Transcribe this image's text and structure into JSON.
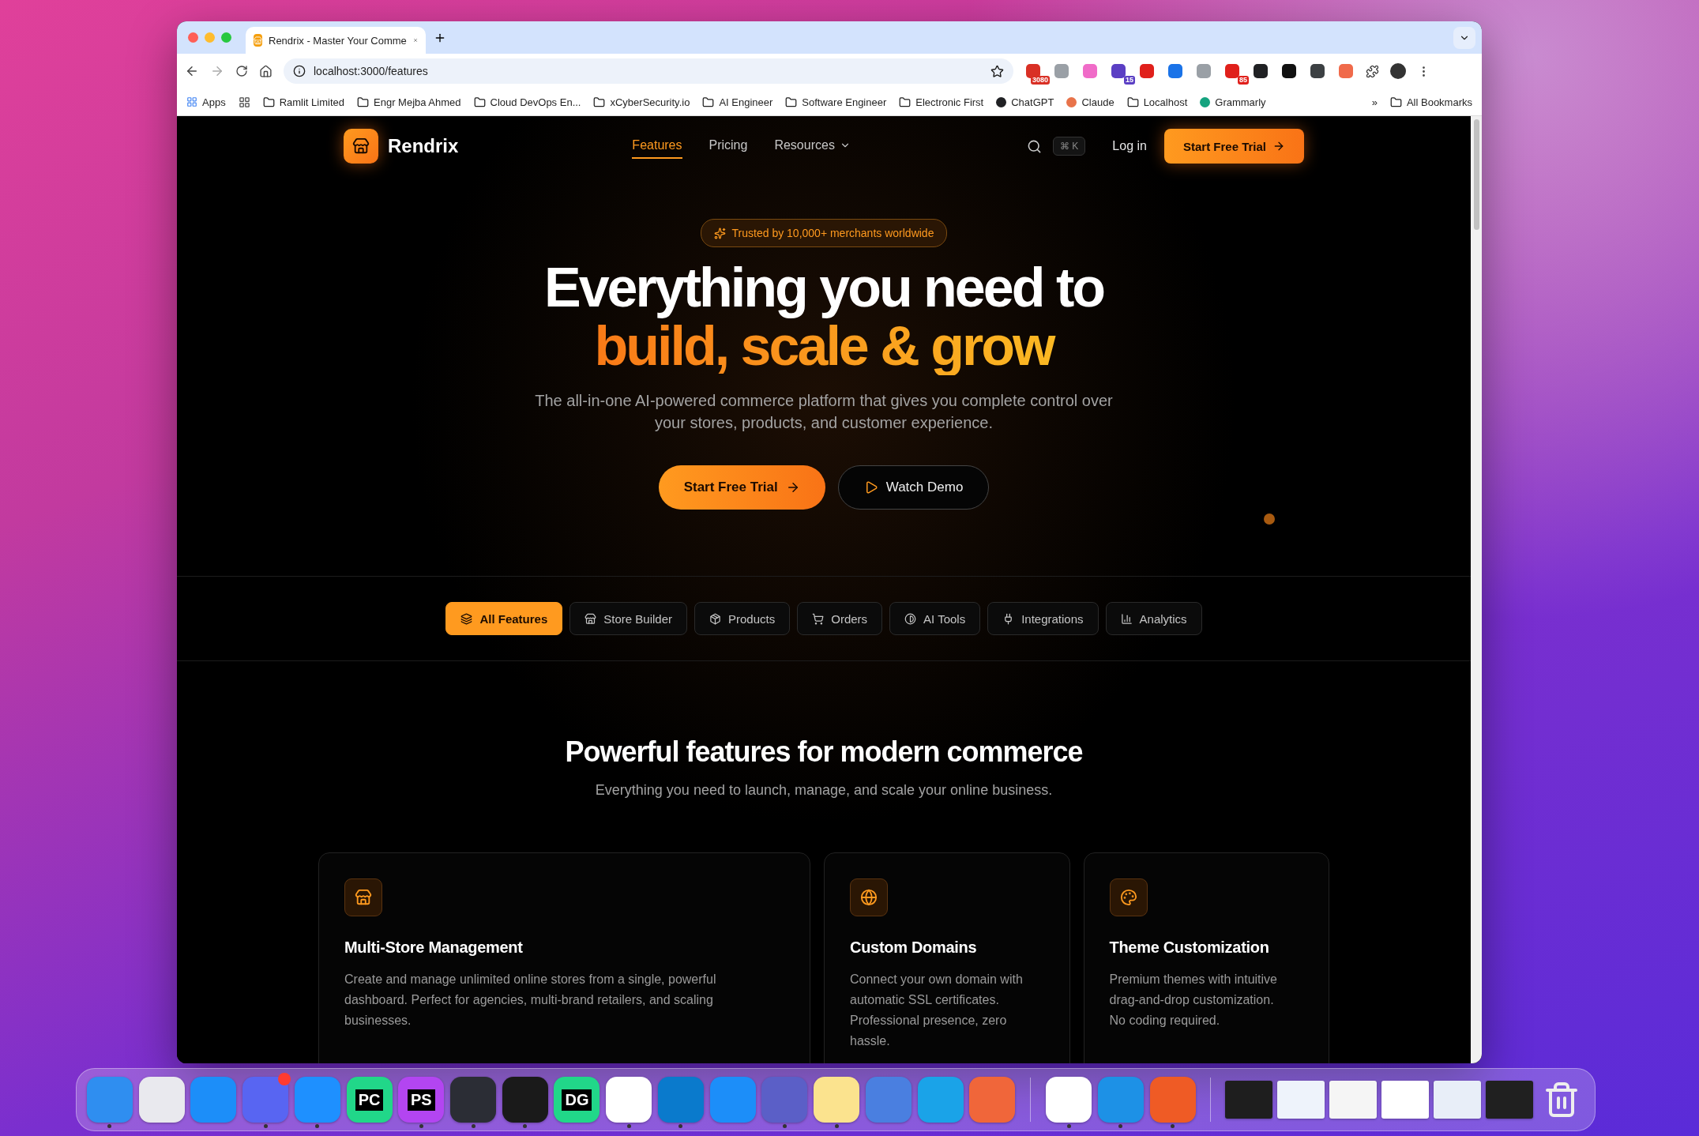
{
  "browser": {
    "tab": {
      "title": "Rendrix - Master Your Comme",
      "selected": true
    },
    "url": "localhost:3000/features",
    "extensions": [
      {
        "badge": "3080",
        "color": "#d93025"
      },
      {
        "color": "#9aa0a6"
      },
      {
        "color": "#f06bc8"
      },
      {
        "badge": "15",
        "color": "#5b3fc4"
      },
      {
        "color": "#e0201b"
      },
      {
        "color": "#1a73e8"
      },
      {
        "color": "#9aa0a6"
      },
      {
        "badge": "85",
        "color": "#e0201b"
      },
      {
        "color": "#202124"
      },
      {
        "color": "#111111"
      },
      {
        "color": "#3c4043"
      },
      {
        "color": "#f06a4a"
      }
    ],
    "bookmarks": [
      {
        "kind": "apps",
        "label": "Apps"
      },
      {
        "kind": "grid"
      },
      {
        "kind": "folder",
        "label": "Ramlit Limited"
      },
      {
        "kind": "folder",
        "label": "Engr Mejba Ahmed"
      },
      {
        "kind": "folder",
        "label": "Cloud DevOps En..."
      },
      {
        "kind": "folder",
        "label": "xCyberSecurity.io"
      },
      {
        "kind": "folder",
        "label": "AI Engineer"
      },
      {
        "kind": "folder",
        "label": "Software Engineer"
      },
      {
        "kind": "folder",
        "label": "Electronic First"
      },
      {
        "kind": "site",
        "label": "ChatGPT",
        "color": "#202124"
      },
      {
        "kind": "site",
        "label": "Claude",
        "color": "#e8734a"
      },
      {
        "kind": "folder",
        "label": "Localhost"
      },
      {
        "kind": "site",
        "label": "Grammarly",
        "color": "#15a37f"
      }
    ],
    "more_bookmarks": "»",
    "all_bookmarks": "All Bookmarks"
  },
  "site": {
    "brand": "Rendrix",
    "nav": [
      {
        "label": "Features",
        "selected": true
      },
      {
        "label": "Pricing",
        "selected": false
      },
      {
        "label": "Resources",
        "selected": false,
        "dropdown": true
      }
    ],
    "shortcut": "⌘ K",
    "login": "Log in",
    "cta": "Start Free Trial",
    "hero": {
      "badge": "Trusted by 10,000+ merchants worldwide",
      "title_line1": "Everything you need to",
      "title_line2": "build, scale & grow",
      "subtitle": "The all-in-one AI-powered commerce platform that gives you complete control over your stores, products, and customer experience.",
      "primary": "Start Free Trial",
      "secondary": "Watch Demo"
    },
    "filters": [
      {
        "label": "All Features",
        "selected": true
      },
      {
        "label": "Store Builder",
        "selected": false
      },
      {
        "label": "Products",
        "selected": false
      },
      {
        "label": "Orders",
        "selected": false
      },
      {
        "label": "AI Tools",
        "selected": false
      },
      {
        "label": "Integrations",
        "selected": false
      },
      {
        "label": "Analytics",
        "selected": false
      }
    ],
    "section": {
      "heading": "Powerful features for modern commerce",
      "subheading": "Everything you need to launch, manage, and scale your online business."
    },
    "cards": [
      {
        "title": "Multi-Store Management",
        "text": "Create and manage unlimited online stores from a single, powerful dashboard. Perfect for agencies, multi-brand retailers, and scaling businesses."
      },
      {
        "title": "Custom Domains",
        "text": "Connect your own domain with automatic SSL certificates. Professional presence, zero hassle."
      },
      {
        "title": "Theme Customization",
        "text": "Premium themes with intuitive drag-and-drop customization. No coding required."
      }
    ]
  },
  "dock": {
    "apps": [
      {
        "color": "#2f8ef0",
        "running": true
      },
      {
        "color": "#e9e9ee",
        "running": false
      },
      {
        "color": "#1c8ef9",
        "running": false
      },
      {
        "color": "#5865f2",
        "running": true,
        "notification": true
      },
      {
        "color": "#1e90ff",
        "running": true
      },
      {
        "color": "#21d789",
        "label": "PC",
        "running": false
      },
      {
        "color": "#b345f1",
        "label": "PS",
        "running": true
      },
      {
        "color": "#2b2d35",
        "running": true
      },
      {
        "color": "#1a1a1a",
        "running": true
      },
      {
        "color": "#21d789",
        "label": "DG",
        "running": false
      },
      {
        "color": "#ffffff",
        "running": true
      },
      {
        "color": "#0a7acc",
        "running": true
      },
      {
        "color": "#1c8ef9",
        "running": false
      },
      {
        "color": "#5b5fc7",
        "running": true
      },
      {
        "color": "#fbe38e",
        "running": true
      },
      {
        "color": "#4a7fe0",
        "running": false
      },
      {
        "color": "#1aa3e8",
        "running": false
      },
      {
        "color": "#f0663a",
        "running": false
      }
    ],
    "apps2": [
      {
        "color": "#ffffff",
        "running": true
      },
      {
        "color": "#1d91e6",
        "running": true
      },
      {
        "color": "#ef5b25",
        "running": true
      }
    ],
    "windows": [
      {
        "color": "#1e1e1e"
      },
      {
        "color": "#eef3fb"
      },
      {
        "color": "#f5f5f5"
      },
      {
        "color": "#ffffff"
      },
      {
        "color": "#e8eef8"
      },
      {
        "color": "#202020"
      }
    ]
  }
}
